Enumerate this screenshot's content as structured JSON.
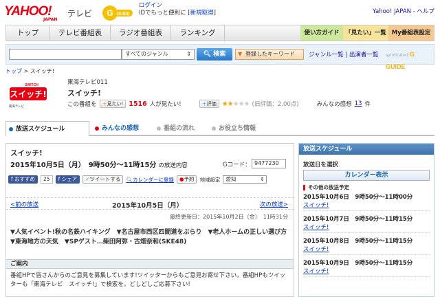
{
  "header": {
    "logo": "YAHOO!",
    "logo_sub": "JAPAN",
    "logo_tv": "テレビ",
    "gguide_label": "G GUIDE",
    "login_link": "ログイン",
    "login_line2_prefix": "IDでもっと便利に [",
    "register_link": "新規取得",
    "login_line2_suffix": "]",
    "yahoo_japan_link": "Yahoo! JAPAN",
    "help_link": "ヘルプ"
  },
  "nav": {
    "tabs": [
      "トップ",
      "テレビ番組表",
      "ラジオ番組表",
      "ランキング"
    ],
    "right": [
      "使い方ガイド",
      "「見たい」一覧",
      "My番組表設定"
    ]
  },
  "search": {
    "input_value": "",
    "genre": "すべてのジャンル",
    "button": "検索",
    "keyword_button": "登録したキーワード",
    "genre_list": "ジャンル一覧",
    "performer_list": "出演者一覧",
    "syndicated": "syndicated",
    "gguide_label": "G GUIDE"
  },
  "breadcrumb": {
    "top": "トップ",
    "sep": ">",
    "current": "スイッチ!"
  },
  "program": {
    "logo_text": "スイッチ!",
    "logo_switch": "SWITCH",
    "logo_station": "東海テレビ",
    "station": "東海テレビ011",
    "title": "スイッチ!",
    "prefix": "この番組を",
    "mitai_button": "見たい!",
    "mitai_count": "1516",
    "mitai_suffix": "人が見たい!",
    "rate_button": "評価",
    "rating_text": "(旧評価：2.00点)",
    "impressions_label": "みんなの感想",
    "impressions_count": "13",
    "impressions_unit": "件",
    "rating_stars": 2,
    "rating_max": 5
  },
  "tabs": [
    {
      "label": "放送スケジュール",
      "state": "active"
    },
    {
      "label": "みんなの感想",
      "state": "link"
    },
    {
      "label": "番組の流れ",
      "state": "disabled"
    },
    {
      "label": "お役立ち情報",
      "state": "disabled"
    }
  ],
  "main": {
    "title": "スイッチ!",
    "date": "2015年10月5日（月）　9時50分～11時15分",
    "date_suffix": "の放送内容",
    "gcode_label": "Gコード：",
    "gcode_value": "9477230",
    "recommend": "おすすめ",
    "recommend_count": "25",
    "share": "シェア",
    "tweet": "ツイートする",
    "calendar": "カレンダーに登録",
    "reserve": "予約",
    "region_label": "地域設定",
    "region_value": "愛知",
    "prev": "<前の放送",
    "center_date": "2015年10月5日（月）",
    "next": "次の放送>",
    "updated": "最終更新日：2015年10月2日（金）　11時31分",
    "description": "▼人気イベント!秋の名鉄ハイキング　▼名古屋市西区四間道をぶらり　▼老人ホームの正しい選び方　▼東海地方の天気　▼SPゲスト…柴田阿弥・古畑奈和(SKE48)",
    "annai_title": "ご案内",
    "annai_text": "番組HPで皆さんからのご意見を募集しています!ツイッターからもご意見お寄せ下さい。番組HPもツイッターも「東海テレビ　スイッチ!」で検索を。どしどしご応募下さい!"
  },
  "sidebar": {
    "header": "放送スケジュール",
    "select_label": "放送日を選択",
    "calendar_button": "カレンダー表示",
    "other_label": "その他の放送予定",
    "items": [
      {
        "date": "2015年10月6日　9時50分～11時00分",
        "title": "スイッチ!"
      },
      {
        "date": "2015年10月7日　9時50分～11時15分",
        "title": "スイッチ!"
      },
      {
        "date": "2015年10月8日　9時50分～11時15分",
        "title": "スイッチ!"
      },
      {
        "date": "2015年10月9日　9時50分～11時15分",
        "title": "スイッチ!"
      }
    ]
  },
  "colors": {
    "accent": "#e60012",
    "link": "#0033cc",
    "sidebar_header": "#3d73ad"
  }
}
